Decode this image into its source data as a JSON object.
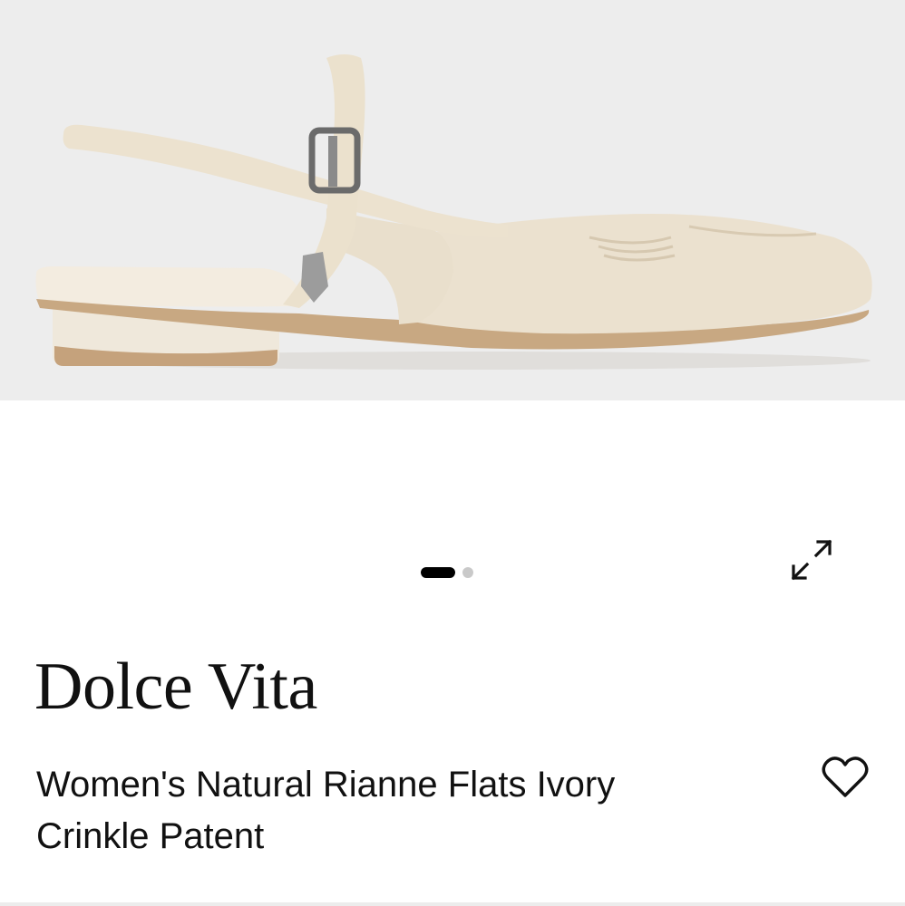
{
  "product_image": {
    "alt": "Rianne Flats Ivory Crinkle Patent",
    "background": "#ededed",
    "shoe_color": "#ece3d2",
    "sole_color": "#c8a882"
  },
  "carousel": {
    "slide_count": 2,
    "active_index": 0,
    "active_color": "#000000",
    "inactive_color": "#c9c9c9"
  },
  "icons": {
    "expand": "expand-arrows-icon",
    "favorite": "heart-outline-icon"
  },
  "product": {
    "brand": "Dolce Vita",
    "title": "Women's Natural Rianne Flats Ivory Crinkle Patent"
  }
}
